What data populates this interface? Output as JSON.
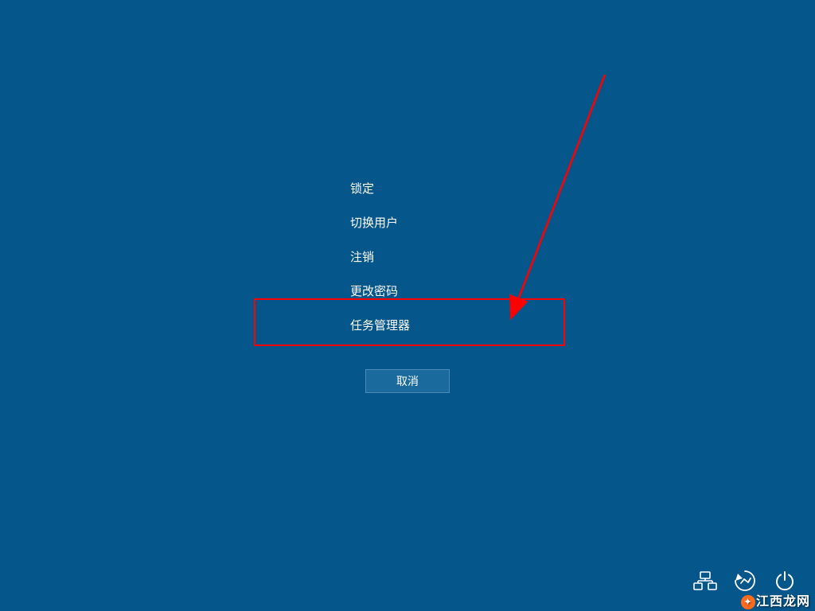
{
  "menu": {
    "items": [
      {
        "label": "锁定"
      },
      {
        "label": "切换用户"
      },
      {
        "label": "注销"
      },
      {
        "label": "更改密码"
      },
      {
        "label": "任务管理器"
      }
    ],
    "cancel_label": "取消"
  },
  "bottom_bar": {
    "network_icon": "network-icon",
    "ease_of_access_icon": "ease-of-access-icon",
    "power_icon": "power-icon"
  },
  "watermark": {
    "text": "江西龙网"
  },
  "annotation": {
    "highlight_index": 4
  }
}
